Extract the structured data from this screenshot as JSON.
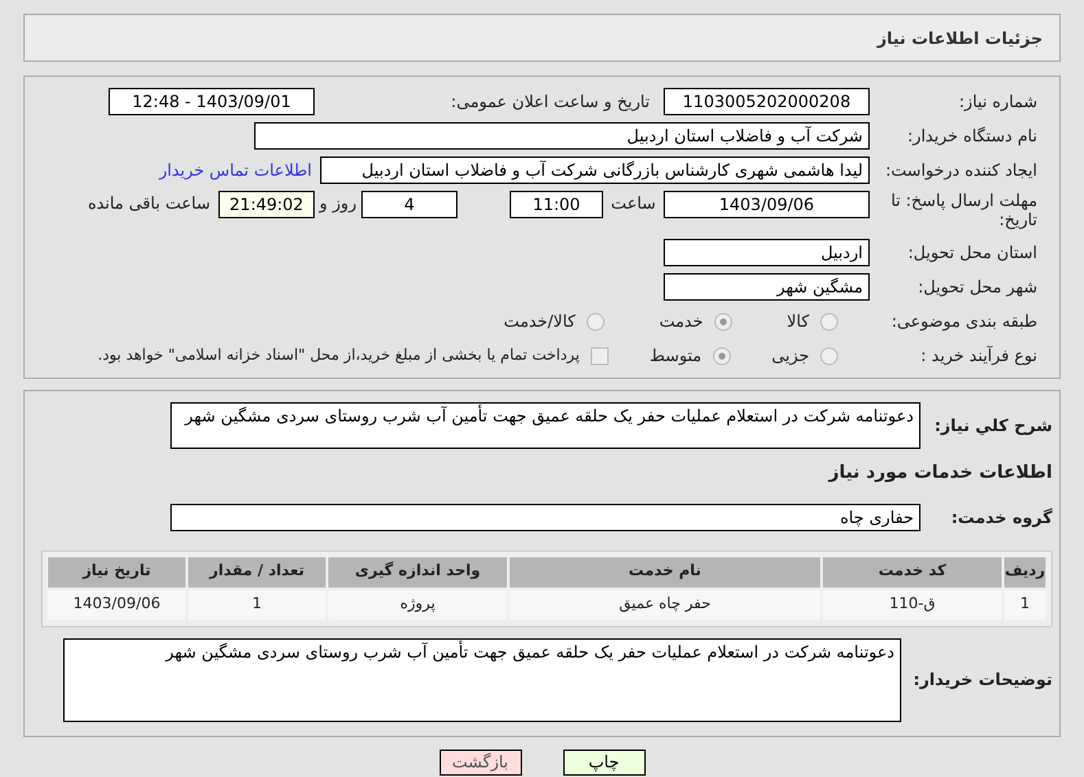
{
  "header": {
    "title": "جزئیات اطلاعات نیاز"
  },
  "need_number": {
    "label": "شماره نیاز:",
    "value": "1103005202000208"
  },
  "announce_date": {
    "label": "تاریخ و ساعت اعلان عمومی:",
    "value": "1403/09/01 - 12:48"
  },
  "buyer_org": {
    "label": "نام دستگاه خریدار:",
    "value": "شرکت آب و فاضلاب استان اردبیل"
  },
  "requester": {
    "label": "ایجاد کننده درخواست:",
    "value": "لیدا  هاشمی شهری کارشناس بازرگانی شرکت آب و فاضلاب استان اردبیل",
    "link": "اطلاعات تماس خریدار"
  },
  "deadline": {
    "label": "مهلت ارسال پاسخ: تا تاریخ:",
    "date": "1403/09/06",
    "time_label": "ساعت",
    "time": "11:00",
    "days": "4",
    "days_label": "روز و",
    "remaining": "21:49:02",
    "remaining_label": "ساعت باقی مانده"
  },
  "province": {
    "label": "استان محل تحویل:",
    "value": "اردبیل"
  },
  "city": {
    "label": "شهر محل تحویل:",
    "value": "مشگین شهر"
  },
  "category": {
    "label": "طبقه بندی موضوعی:",
    "options": [
      {
        "label": "کالا",
        "selected": false
      },
      {
        "label": "خدمت",
        "selected": true
      },
      {
        "label": "کالا/خدمت",
        "selected": false
      }
    ]
  },
  "process": {
    "label": "نوع فرآیند خرید :",
    "options": [
      {
        "label": "جزیی",
        "selected": false
      },
      {
        "label": "متوسط",
        "selected": true
      }
    ],
    "payment": {
      "checked": false,
      "label": "پرداخت تمام یا بخشی از مبلغ خرید،از محل \"اسناد خزانه اسلامی\" خواهد بود."
    }
  },
  "summary": {
    "label": "شرح کلي نياز:",
    "value": "دعوتنامه شرکت در استعلام  عملیات حفر یک حلقه عمیق جهت تأمین آب شرب روستای سردی مشگین شهر"
  },
  "services_heading": "اطلاعات خدمات مورد نياز",
  "service_group": {
    "label": "گروه خدمت:",
    "value": "حفاری چاه"
  },
  "table": {
    "columns": [
      "رديف",
      "کد خدمت",
      "نام خدمت",
      "واحد اندازه گیری",
      "تعداد / مقدار",
      "تاریخ نیاز"
    ],
    "rows": [
      [
        "1",
        "ق-110",
        "حفر چاه عمیق",
        "پروژه",
        "1",
        "1403/09/06"
      ]
    ]
  },
  "buyer_notes": {
    "label": "توضیحات خریدار:",
    "value": "دعوتنامه شرکت در استعلام  عملیات حفر یک حلقه عمیق جهت تأمین آب شرب روستای سردی مشگین شهر"
  },
  "buttons": [
    {
      "label": "چاپ",
      "kind": "print"
    },
    {
      "label": "بازگشت",
      "kind": "back"
    }
  ]
}
